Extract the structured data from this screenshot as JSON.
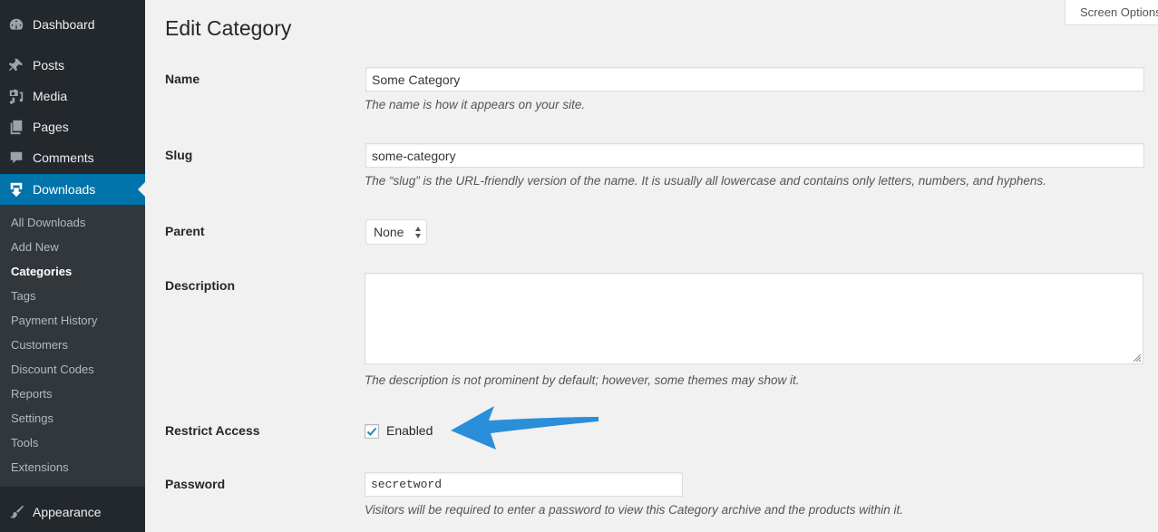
{
  "sidebar": {
    "menu": [
      {
        "label": "Dashboard",
        "icon": "dashboard-icon"
      },
      {
        "label": "Posts",
        "icon": "pushpin-icon"
      },
      {
        "label": "Media",
        "icon": "media-icon"
      },
      {
        "label": "Pages",
        "icon": "pages-icon"
      },
      {
        "label": "Comments",
        "icon": "comment-icon"
      },
      {
        "label": "Downloads",
        "icon": "download-icon",
        "active": true
      },
      {
        "label": "Appearance",
        "icon": "paintbrush-icon"
      }
    ],
    "submenu": [
      {
        "label": "All Downloads"
      },
      {
        "label": "Add New"
      },
      {
        "label": "Categories",
        "current": true
      },
      {
        "label": "Tags"
      },
      {
        "label": "Payment History"
      },
      {
        "label": "Customers"
      },
      {
        "label": "Discount Codes"
      },
      {
        "label": "Reports"
      },
      {
        "label": "Settings"
      },
      {
        "label": "Tools"
      },
      {
        "label": "Extensions"
      }
    ]
  },
  "header": {
    "screen_options_label": "Screen Options",
    "title": "Edit Category"
  },
  "form": {
    "name": {
      "label": "Name",
      "value": "Some Category",
      "description": "The name is how it appears on your site."
    },
    "slug": {
      "label": "Slug",
      "value": "some-category",
      "description": "The “slug” is the URL-friendly version of the name. It is usually all lowercase and contains only letters, numbers, and hyphens."
    },
    "parent": {
      "label": "Parent",
      "selected": "None"
    },
    "description": {
      "label": "Description",
      "value": "",
      "description": "The description is not prominent by default; however, some themes may show it."
    },
    "restrict_access": {
      "label": "Restrict Access",
      "checkbox_label": "Enabled",
      "checked": true
    },
    "password": {
      "label": "Password",
      "value": "secretword",
      "description": "Visitors will be required to enter a password to view this Category archive and the products within it."
    }
  },
  "colors": {
    "sidebar_bg": "#23282d",
    "submenu_bg": "#32373c",
    "active_accent": "#0073aa",
    "annotation_arrow": "#2a8fd8",
    "checkmark": "#1e8cbe"
  }
}
